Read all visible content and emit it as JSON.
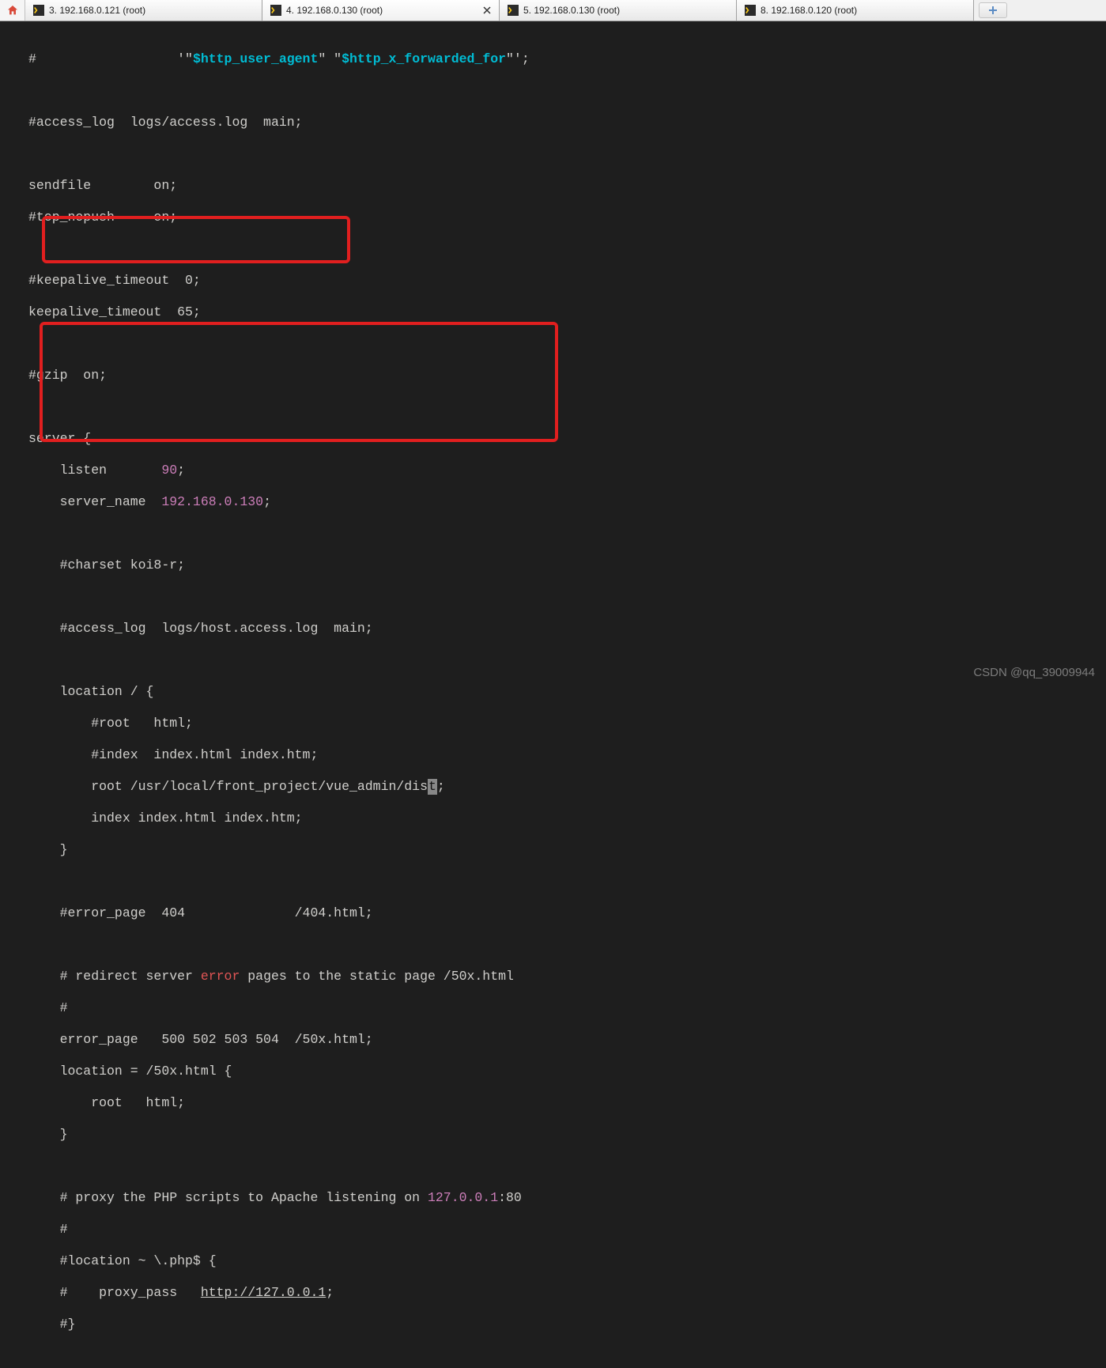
{
  "tabs": [
    {
      "label": "3. 192.168.0.121 (root)"
    },
    {
      "label": "4. 192.168.0.130 (root)"
    },
    {
      "label": "5. 192.168.0.130 (root)"
    },
    {
      "label": "8. 192.168.0.120 (root)"
    }
  ],
  "active_tab_index": 1,
  "code": {
    "l1_a": "#                  '\"",
    "l1_b": "$http_user_agent",
    "l1_c": "\" \"",
    "l1_d": "$http_x_forwarded_for",
    "l1_e": "\"';",
    "l3": "#access_log  logs/access.log  main;",
    "l5": "sendfile        on;",
    "l6": "#tcp_nopush     on;",
    "l8": "#keepalive_timeout  0;",
    "l9": "keepalive_timeout  65;",
    "l11": "#gzip  on;",
    "l13": "server {",
    "l14a": "    listen       ",
    "l14b": "90",
    "l14c": ";",
    "l15a": "    server_name  ",
    "l15b": "192.168.0.130",
    "l15c": ";",
    "l17": "    #charset koi8-r;",
    "l19": "    #access_log  logs/host.access.log  main;",
    "l21": "    location / {",
    "l22": "        #root   html;",
    "l23": "        #index  index.html index.htm;",
    "l24a": "        root /usr/local/front_project/vue_admin/dis",
    "l24b": "t",
    "l24c": ";",
    "l25": "        index index.html index.htm;",
    "l26": "    }",
    "l28": "    #error_page  404              /404.html;",
    "l30a": "    # redirect server ",
    "l30b": "error",
    "l30c": " pages to the static page /50x.html",
    "l31": "    #",
    "l32": "    error_page   500 502 503 504  /50x.html;",
    "l33": "    location = /50x.html {",
    "l34": "        root   html;",
    "l35": "    }",
    "l37a": "    # proxy the PHP scripts to Apache listening on ",
    "l37b": "127.0.0.1",
    "l37c": ":80",
    "l38": "    #",
    "l39": "    #location ~ \\.php$ {",
    "l40a": "    #    proxy_pass   ",
    "l40b": "http://127.0.0.1",
    "l40c": ";",
    "l41": "    #}"
  },
  "watermark": "CSDN @qq_39009944"
}
